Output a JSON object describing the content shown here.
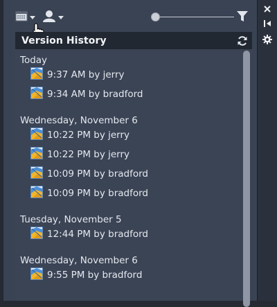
{
  "panel": {
    "title": "Version History"
  },
  "icons": {
    "calendar": "calendar-icon",
    "user": "user-icon",
    "filter": "filter-icon",
    "refresh": "refresh-icon",
    "close": "close-icon",
    "collapse": "collapse-icon",
    "settings": "gear-icon",
    "version": "map-version-icon"
  },
  "slider": {
    "value": 0
  },
  "colors": {
    "panel_bg": "#3b4455",
    "header_bg": "#222832",
    "text": "#e4e8ee"
  },
  "history": [
    {
      "date": "Today",
      "entries": [
        "9:37 AM by jerry",
        "9:34 AM by bradford"
      ]
    },
    {
      "date": "Wednesday, November 6",
      "entries": [
        "10:22 PM by jerry",
        "10:22 PM by jerry",
        "10:09 PM by bradford",
        "10:09 PM by bradford"
      ]
    },
    {
      "date": "Tuesday, November 5",
      "entries": [
        "12:44 PM by bradford"
      ]
    },
    {
      "date": "Wednesday, November 6",
      "entries": [
        "9:55 PM by bradford"
      ]
    }
  ]
}
